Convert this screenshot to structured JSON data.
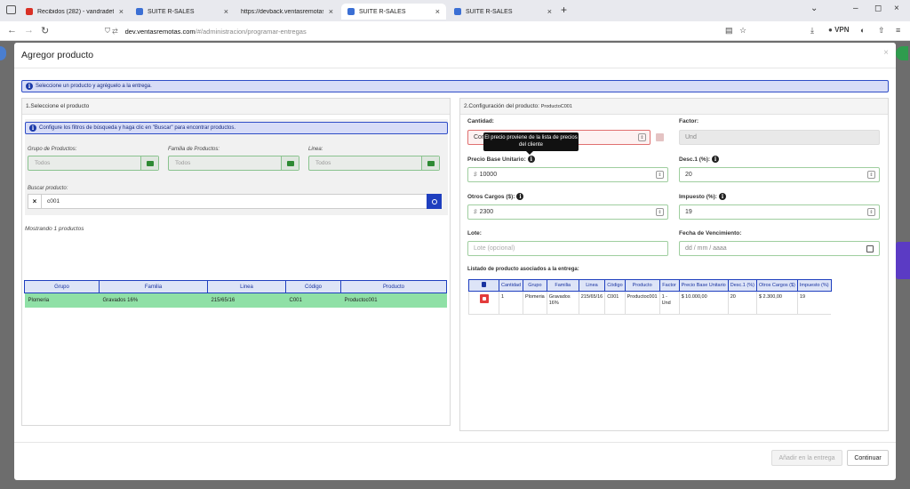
{
  "browser": {
    "tabs": [
      {
        "label": "Recibidos (282) - vandradet06@",
        "favicon_color": "#d93025",
        "active": false
      },
      {
        "label": "SUITE R-SALES",
        "favicon_color": "#3b6fd4",
        "active": false
      },
      {
        "label": "https://devback.ventasremotas",
        "favicon_color": "#bbbbbb",
        "active": false
      },
      {
        "label": "SUITE R-SALES",
        "favicon_color": "#3b6fd4",
        "active": true
      },
      {
        "label": "SUITE R-SALES",
        "favicon_color": "#3b6fd4",
        "active": false
      }
    ],
    "url_domain": "dev.ventasremotas.com",
    "url_path": "/#/administracion/programar-entregas",
    "vpn_label": "VPN"
  },
  "modal": {
    "title": "Agregor producto",
    "main_alert": "Seleccione un producto y agréguelo a la entrega.",
    "left": {
      "title": "1.Seleccione el producto",
      "filter_alert": "Configure los filtros de búsqueda y haga clic en \"Buscar\" para encontrar productos.",
      "group_label": "Grupo de Productos:",
      "group_value": "Todos",
      "family_label": "Familia de Productos:",
      "family_value": "Todos",
      "line_label": "Linea:",
      "line_value": "Todos",
      "search_label": "Buscar producto:",
      "search_value": "c001",
      "clear_symbol": "×",
      "results_text": "Mostrando 1 productos",
      "columns": [
        "Grupo",
        "Familia",
        "Linea",
        "Código",
        "Producto"
      ],
      "rows": [
        [
          "Plomeria",
          "Gravados 16%",
          "215/65/16",
          "C001",
          "Productoc001"
        ]
      ]
    },
    "right": {
      "title_prefix": "2.Configuración del producto:",
      "title_product": "ProductoC001",
      "qty_label": "Cantidad:",
      "qty_value": "Cor",
      "tooltip": "El precio proviene de la lista de precios del cliente",
      "factor_label": "Factor:",
      "factor_value": "Und",
      "price_label": "Precio Base Unitario:",
      "price_value": "10000",
      "disc_label": "Desc.1 (%):",
      "disc_value": "20",
      "other_label": "Otros Cargos ($):",
      "other_value": "2300",
      "tax_label": "Impuesto (%):",
      "tax_value": "19",
      "lot_label": "Lote:",
      "lot_placeholder": "Lote (opcional)",
      "exp_label": "Fecha de Vencimiento:",
      "exp_placeholder": "dd / mm / aaaa",
      "currency": "$",
      "spin_symbol": "⇕",
      "list_title": "Listado de producto asociados a la entrega:",
      "list_columns": [
        "Cantidad",
        "Grupo",
        "Familia",
        "Linea",
        "Código",
        "Producto",
        "Factor",
        "Precio Base Unitario",
        "Desc.1 (%)",
        "Otros Cargos ($)",
        "Impuesto (%)"
      ],
      "list_rows": [
        [
          "1",
          "Plomeria",
          "Gravados 16%",
          "215/65/16",
          "C001",
          "Productoc001",
          "1 - Und",
          "$ 10.000,00",
          "20",
          "$ 2.300,00",
          "19"
        ]
      ]
    },
    "btn_add": "Añadir en la entrega",
    "btn_continue": "Continuar"
  },
  "colors": {
    "accent": "#1f3fbf",
    "success": "#8fe0a6",
    "danger": "#e33b3b"
  }
}
